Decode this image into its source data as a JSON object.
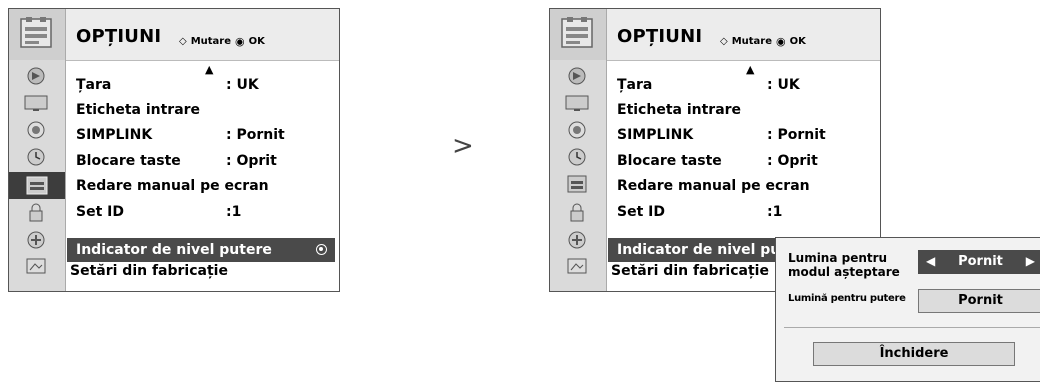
{
  "menu": {
    "title": "OPȚIUNI",
    "hint_move": "Mutare",
    "hint_ok": "OK",
    "items": [
      {
        "label": "Țara",
        "value": ": UK"
      },
      {
        "label": "Eticheta intrare",
        "value": ""
      },
      {
        "label": "SIMPLINK",
        "value": ": Pornit"
      },
      {
        "label": "Blocare taste",
        "value": ": Oprit"
      },
      {
        "label": "Redare manual pe ecran",
        "value": ""
      },
      {
        "label": "Set ID",
        "value": ":1"
      },
      {
        "label": "Indicator de nivel putere",
        "value": ""
      },
      {
        "label": "Setări din fabricație",
        "value": ""
      }
    ]
  },
  "menu_right": {
    "selected_label": "Indicator de nivel pu"
  },
  "transition": ">",
  "popup": {
    "standby_label": "Lumina pentru modul așteptare",
    "standby_label_line1": "Lumina pentru",
    "standby_label_line2": "modul așteptare",
    "standby_value": "Pornit",
    "power_label": "Lumină pentru putere",
    "power_value": "Pornit",
    "close_label": "Închidere"
  },
  "icons": [
    "options-icon",
    "picture-icon",
    "tv-icon",
    "audio-icon",
    "time-icon",
    "option-icon",
    "lock-icon",
    "input-icon",
    "usb-icon"
  ]
}
